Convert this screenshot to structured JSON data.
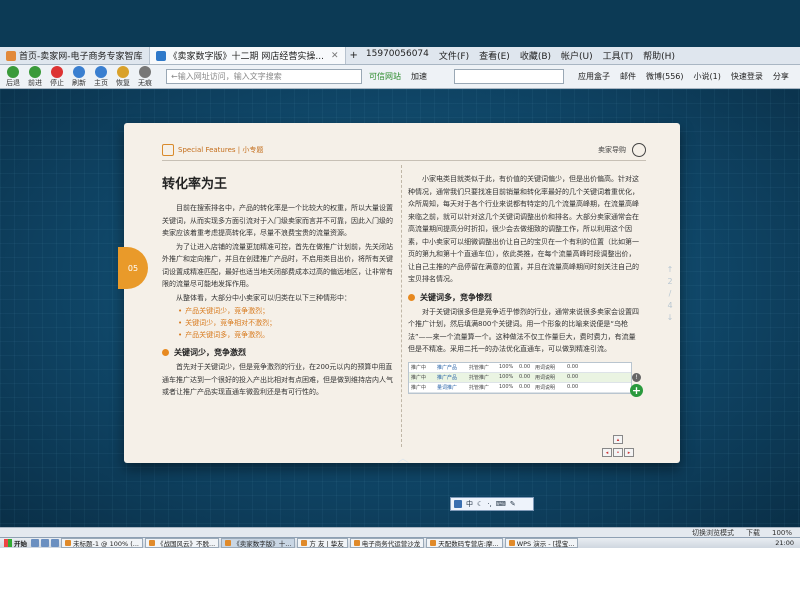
{
  "browser": {
    "tabs": [
      {
        "label": "首页-卖家网-电子商务专家智库",
        "active": false
      },
      {
        "label": "《卖家数字版》十二期 网店经营实操...",
        "active": true
      }
    ],
    "phone": "15970056074",
    "menus": [
      "文件(F)",
      "查看(E)",
      "收藏(B)",
      "帐户(U)",
      "工具(T)",
      "帮助(H)"
    ],
    "nav_buttons": [
      {
        "label": "后退",
        "color": "#3a9a3a"
      },
      {
        "label": "前进",
        "color": "#3a9a3a"
      },
      {
        "label": "停止",
        "color": "#d33"
      },
      {
        "label": "刷新",
        "color": "#3a7fd0"
      },
      {
        "label": "主页",
        "color": "#3a7fd0"
      },
      {
        "label": "恢复",
        "color": "#d9a12a"
      },
      {
        "label": "无痕",
        "color": "#777"
      }
    ],
    "address_placeholder": "←输入网址访问，输入文字搜索",
    "secure_label": "可信网站",
    "accelerate_label": "加速",
    "right_tools": [
      "应用盒子",
      "邮件",
      "微博(556)",
      "小说(1)",
      "快速登录",
      "分享"
    ]
  },
  "magazine": {
    "section_label": "Special Features | 小专题",
    "header_right": "卖家导购",
    "page_badge": "05",
    "pager": [
      "2",
      "/",
      "4"
    ],
    "left": {
      "title": "转化率为王",
      "paragraphs": [
        "目前在搜索排名中，产品的转化率是一个比较大的权重，所以大量设置关键词，从而实现多方面引流对于入门级卖家而言并不可靠，因此入门级的卖家应该着重考虑提高转化率，尽量不浪费宝贵的流量资源。",
        "为了让进入店铺的流量更加精准可控，首先在做推广计划前，先关闭站外推广和定向推广，并且在创建推广产品时，不启用类目出价，将所有关键词设置成精准匹配，最好也适当地关闭部费成本过高的偏远地区，让非常有限的流量尽可能地发挥作用。",
        "从整体看，大部分中小卖家可以归类在以下三种情形中："
      ],
      "bullets": [
        "产品关键词少，竞争激烈；",
        "关键词少，竞争相对不激烈；",
        "产品关键词多，竞争激烈。"
      ],
      "section_title": "关键词少，竞争激烈",
      "section_text": "首先对于关键词少，但是竞争激烈的行业，在200元以内的预算中用直通车推广达到一个很好的投入产出比相对有点困难，但是做到维持店内人气或者让推广产品实现直通车微盈利还是有可行性的。"
    },
    "right": {
      "paragraphs": [
        "小家电类目就类似于此，有价值的关键词偏少，但是出价偏高。针对这种情况，通常我们只要找准目前销量和转化率最好的几个关键词着重优化，众所周知，每天对于各个行业来说都有特定的几个流量高峰期，在流量高峰来临之前，就可以针对这几个关键词调整出价和排名。大部分卖家通常会在高流量期间提高分时折扣，很少会去做细致的调整工作，所以利用这个因素，中小卖家可以细微调整出价让自己的宝贝在一个有利的位置（比如第一页的第九和第十个直通车位），依此类推，在每个流量高峰时段调整出价，让自己主推的产品停留在满意的位置，并且在流量高峰期间时刻关注自己的宝贝排名情况。"
      ],
      "section_title": "关键词多，竞争惨烈",
      "section_text": "对于关键词很多但是竞争近乎惨烈的行业，通常来说很多卖家会设置四个推广计划，然后填满800个关键词。用一个形象的比喻来说便是“乌枪法”——来一个流量算一个。这种做法不仅工作量巨大，费时费力，有流量但是不精准。采用二托一的办法优化直通车，可以做到精准引流。",
      "table_rows": [
        [
          "推广中",
          "推广产品",
          "托管推广",
          "100%",
          "0.00",
          "用词说明",
          "0.00"
        ],
        [
          "推广中",
          "推广产品",
          "托管推广",
          "100%",
          "0.00",
          "用词说明",
          "0.00"
        ],
        [
          "推广中",
          "量词推广",
          "托管推广",
          "100%",
          "0.00",
          "用词说明",
          "0.00"
        ]
      ]
    }
  },
  "ime": {
    "label": "中"
  },
  "status": {
    "view_mode": "切换浏览模式",
    "download": "下载",
    "zoom": "100%"
  },
  "taskbar": {
    "start": "开始",
    "tasks": [
      {
        "label": "未标题-1 @ 100% (...",
        "active": false
      },
      {
        "label": "《战国风云》不脱...",
        "active": false
      },
      {
        "label": "《卖家数字版》十...",
        "active": true
      },
      {
        "label": "方 友 | 挚友",
        "active": false
      },
      {
        "label": "电子商务代运营沙龙",
        "active": false
      },
      {
        "label": "天配数码专营店:摩...",
        "active": false
      },
      {
        "label": "WPS 演示 - [提宝...",
        "active": false
      }
    ],
    "clock": "21:00"
  }
}
